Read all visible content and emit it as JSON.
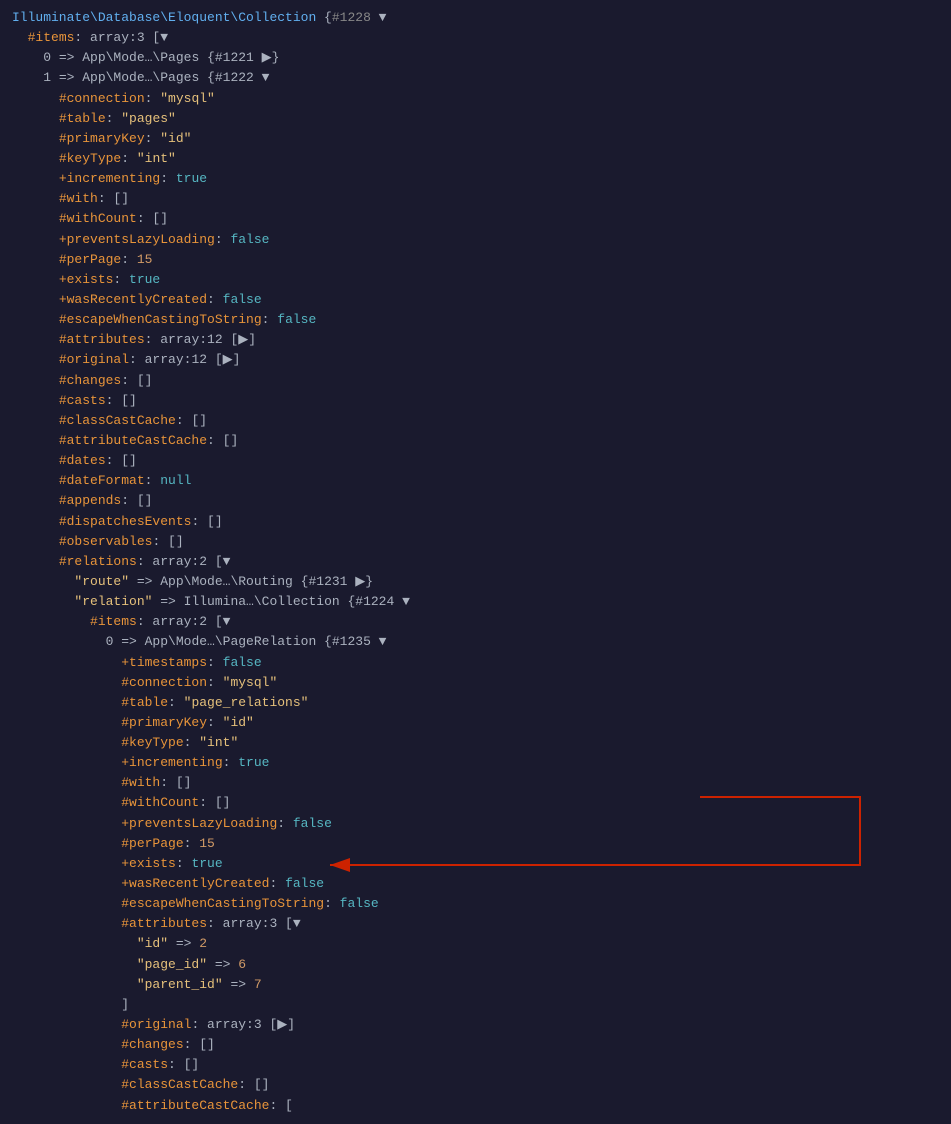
{
  "title": "Illuminate\\Database\\Eloquent\\Collection {#1228}",
  "lines": [
    {
      "indent": 0,
      "content": [
        {
          "t": "class",
          "v": "Illuminate\\Database\\Eloquent\\Collection",
          "c": "classname"
        },
        {
          "t": "plain",
          "v": " {",
          "c": "gray"
        },
        {
          "t": "plain",
          "v": "#1228",
          "c": "id-hash"
        },
        {
          "t": "plain",
          "v": " ▼",
          "c": "gray"
        }
      ]
    },
    {
      "indent": 1,
      "content": [
        {
          "t": "plain",
          "v": "#items",
          "c": "hash-key"
        },
        {
          "t": "plain",
          "v": ": array:3 [▼",
          "c": "gray"
        }
      ]
    },
    {
      "indent": 2,
      "content": [
        {
          "t": "plain",
          "v": "0 => App\\Mode…\\Pages {#1221 ▶}",
          "c": "gray"
        }
      ]
    },
    {
      "indent": 2,
      "content": [
        {
          "t": "plain",
          "v": "1 => App\\Mode…\\Pages {#1222 ▼",
          "c": "gray"
        }
      ]
    },
    {
      "indent": 3,
      "content": [
        {
          "t": "plain",
          "v": "#connection",
          "c": "hash-key"
        },
        {
          "t": "plain",
          "v": ": ",
          "c": "gray"
        },
        {
          "t": "plain",
          "v": "\"mysql\"",
          "c": "string"
        }
      ]
    },
    {
      "indent": 3,
      "content": [
        {
          "t": "plain",
          "v": "#table",
          "c": "hash-key"
        },
        {
          "t": "plain",
          "v": ": ",
          "c": "gray"
        },
        {
          "t": "plain",
          "v": "\"pages\"",
          "c": "string"
        }
      ]
    },
    {
      "indent": 3,
      "content": [
        {
          "t": "plain",
          "v": "#primaryKey",
          "c": "hash-key"
        },
        {
          "t": "plain",
          "v": ": ",
          "c": "gray"
        },
        {
          "t": "plain",
          "v": "\"id\"",
          "c": "string"
        }
      ]
    },
    {
      "indent": 3,
      "content": [
        {
          "t": "plain",
          "v": "#keyType",
          "c": "hash-key"
        },
        {
          "t": "plain",
          "v": ": ",
          "c": "gray"
        },
        {
          "t": "plain",
          "v": "\"int\"",
          "c": "string"
        }
      ]
    },
    {
      "indent": 3,
      "content": [
        {
          "t": "plain",
          "v": "+incrementing",
          "c": "plus-key"
        },
        {
          "t": "plain",
          "v": ": ",
          "c": "gray"
        },
        {
          "t": "plain",
          "v": "true",
          "c": "kw-true"
        }
      ]
    },
    {
      "indent": 3,
      "content": [
        {
          "t": "plain",
          "v": "#with",
          "c": "hash-key"
        },
        {
          "t": "plain",
          "v": ": []",
          "c": "gray"
        }
      ]
    },
    {
      "indent": 3,
      "content": [
        {
          "t": "plain",
          "v": "#withCount",
          "c": "hash-key"
        },
        {
          "t": "plain",
          "v": ": []",
          "c": "gray"
        }
      ]
    },
    {
      "indent": 3,
      "content": [
        {
          "t": "plain",
          "v": "+preventsLazyLoading",
          "c": "plus-key"
        },
        {
          "t": "plain",
          "v": ": ",
          "c": "gray"
        },
        {
          "t": "plain",
          "v": "false",
          "c": "kw-false"
        }
      ]
    },
    {
      "indent": 3,
      "content": [
        {
          "t": "plain",
          "v": "#perPage",
          "c": "hash-key"
        },
        {
          "t": "plain",
          "v": ": ",
          "c": "gray"
        },
        {
          "t": "plain",
          "v": "15",
          "c": "num"
        }
      ]
    },
    {
      "indent": 3,
      "content": [
        {
          "t": "plain",
          "v": "+exists",
          "c": "plus-key"
        },
        {
          "t": "plain",
          "v": ": ",
          "c": "gray"
        },
        {
          "t": "plain",
          "v": "true",
          "c": "kw-true"
        }
      ]
    },
    {
      "indent": 3,
      "content": [
        {
          "t": "plain",
          "v": "+wasRecentlyCreated",
          "c": "plus-key"
        },
        {
          "t": "plain",
          "v": ": ",
          "c": "gray"
        },
        {
          "t": "plain",
          "v": "false",
          "c": "kw-false"
        }
      ]
    },
    {
      "indent": 3,
      "content": [
        {
          "t": "plain",
          "v": "#escapeWhenCastingToString",
          "c": "hash-key"
        },
        {
          "t": "plain",
          "v": ": ",
          "c": "gray"
        },
        {
          "t": "plain",
          "v": "false",
          "c": "kw-false"
        }
      ]
    },
    {
      "indent": 3,
      "content": [
        {
          "t": "plain",
          "v": "#attributes",
          "c": "hash-key"
        },
        {
          "t": "plain",
          "v": ": array:12 [▶]",
          "c": "gray"
        }
      ]
    },
    {
      "indent": 3,
      "content": [
        {
          "t": "plain",
          "v": "#original",
          "c": "hash-key"
        },
        {
          "t": "plain",
          "v": ": array:12 [▶]",
          "c": "gray"
        }
      ]
    },
    {
      "indent": 3,
      "content": [
        {
          "t": "plain",
          "v": "#changes",
          "c": "hash-key"
        },
        {
          "t": "plain",
          "v": ": []",
          "c": "gray"
        }
      ]
    },
    {
      "indent": 3,
      "content": [
        {
          "t": "plain",
          "v": "#casts",
          "c": "hash-key"
        },
        {
          "t": "plain",
          "v": ": []",
          "c": "gray"
        }
      ]
    },
    {
      "indent": 3,
      "content": [
        {
          "t": "plain",
          "v": "#classCastCache",
          "c": "hash-key"
        },
        {
          "t": "plain",
          "v": ": []",
          "c": "gray"
        }
      ]
    },
    {
      "indent": 3,
      "content": [
        {
          "t": "plain",
          "v": "#attributeCastCache",
          "c": "hash-key"
        },
        {
          "t": "plain",
          "v": ": []",
          "c": "gray"
        }
      ]
    },
    {
      "indent": 3,
      "content": [
        {
          "t": "plain",
          "v": "#dates",
          "c": "hash-key"
        },
        {
          "t": "plain",
          "v": ": []",
          "c": "gray"
        }
      ]
    },
    {
      "indent": 3,
      "content": [
        {
          "t": "plain",
          "v": "#dateFormat",
          "c": "hash-key"
        },
        {
          "t": "plain",
          "v": ": ",
          "c": "gray"
        },
        {
          "t": "plain",
          "v": "null",
          "c": "kw-null"
        }
      ]
    },
    {
      "indent": 3,
      "content": [
        {
          "t": "plain",
          "v": "#appends",
          "c": "hash-key"
        },
        {
          "t": "plain",
          "v": ": []",
          "c": "gray"
        }
      ]
    },
    {
      "indent": 3,
      "content": [
        {
          "t": "plain",
          "v": "#dispatchesEvents",
          "c": "hash-key"
        },
        {
          "t": "plain",
          "v": ": []",
          "c": "gray"
        }
      ]
    },
    {
      "indent": 3,
      "content": [
        {
          "t": "plain",
          "v": "#observables",
          "c": "hash-key"
        },
        {
          "t": "plain",
          "v": ": []",
          "c": "gray"
        }
      ]
    },
    {
      "indent": 3,
      "content": [
        {
          "t": "plain",
          "v": "#relations",
          "c": "hash-key"
        },
        {
          "t": "plain",
          "v": ": array:2 [▼",
          "c": "gray"
        }
      ]
    },
    {
      "indent": 4,
      "content": [
        {
          "t": "plain",
          "v": "\"route\"",
          "c": "string"
        },
        {
          "t": "plain",
          "v": " => App\\Mode…\\Routing {#1231 ▶}",
          "c": "gray"
        }
      ]
    },
    {
      "indent": 4,
      "content": [
        {
          "t": "plain",
          "v": "\"relation\"",
          "c": "string"
        },
        {
          "t": "plain",
          "v": " => Illumina…\\Collection {#1224 ▼",
          "c": "gray"
        }
      ]
    },
    {
      "indent": 5,
      "content": [
        {
          "t": "plain",
          "v": "#items",
          "c": "hash-key"
        },
        {
          "t": "plain",
          "v": ": array:2 [▼",
          "c": "gray"
        }
      ]
    },
    {
      "indent": 6,
      "content": [
        {
          "t": "plain",
          "v": "0 => App\\Mode…\\PageRelation {#1235 ▼",
          "c": "gray"
        }
      ]
    },
    {
      "indent": 7,
      "content": [
        {
          "t": "plain",
          "v": "+timestamps",
          "c": "plus-key"
        },
        {
          "t": "plain",
          "v": ": ",
          "c": "gray"
        },
        {
          "t": "plain",
          "v": "false",
          "c": "kw-false"
        }
      ]
    },
    {
      "indent": 7,
      "content": [
        {
          "t": "plain",
          "v": "#connection",
          "c": "hash-key"
        },
        {
          "t": "plain",
          "v": ": ",
          "c": "gray"
        },
        {
          "t": "plain",
          "v": "\"mysql\"",
          "c": "string"
        }
      ]
    },
    {
      "indent": 7,
      "content": [
        {
          "t": "plain",
          "v": "#table",
          "c": "hash-key"
        },
        {
          "t": "plain",
          "v": ": ",
          "c": "gray"
        },
        {
          "t": "plain",
          "v": "\"page_relations\"",
          "c": "string"
        }
      ]
    },
    {
      "indent": 7,
      "content": [
        {
          "t": "plain",
          "v": "#primaryKey",
          "c": "hash-key"
        },
        {
          "t": "plain",
          "v": ": ",
          "c": "gray"
        },
        {
          "t": "plain",
          "v": "\"id\"",
          "c": "string"
        }
      ]
    },
    {
      "indent": 7,
      "content": [
        {
          "t": "plain",
          "v": "#keyType",
          "c": "hash-key"
        },
        {
          "t": "plain",
          "v": ": ",
          "c": "gray"
        },
        {
          "t": "plain",
          "v": "\"int\"",
          "c": "string"
        }
      ]
    },
    {
      "indent": 7,
      "content": [
        {
          "t": "plain",
          "v": "+incrementing",
          "c": "plus-key"
        },
        {
          "t": "plain",
          "v": ": ",
          "c": "gray"
        },
        {
          "t": "plain",
          "v": "true",
          "c": "kw-true"
        }
      ]
    },
    {
      "indent": 7,
      "content": [
        {
          "t": "plain",
          "v": "#with",
          "c": "hash-key"
        },
        {
          "t": "plain",
          "v": ": []",
          "c": "gray"
        }
      ]
    },
    {
      "indent": 7,
      "content": [
        {
          "t": "plain",
          "v": "#withCount",
          "c": "hash-key"
        },
        {
          "t": "plain",
          "v": ": []",
          "c": "gray"
        }
      ]
    },
    {
      "indent": 7,
      "content": [
        {
          "t": "plain",
          "v": "+preventsLazyLoading",
          "c": "plus-key"
        },
        {
          "t": "plain",
          "v": ": ",
          "c": "gray"
        },
        {
          "t": "plain",
          "v": "false",
          "c": "kw-false"
        }
      ]
    },
    {
      "indent": 7,
      "content": [
        {
          "t": "plain",
          "v": "#perPage",
          "c": "hash-key"
        },
        {
          "t": "plain",
          "v": ": ",
          "c": "gray"
        },
        {
          "t": "plain",
          "v": "15",
          "c": "num"
        }
      ]
    },
    {
      "indent": 7,
      "content": [
        {
          "t": "plain",
          "v": "+exists",
          "c": "plus-key"
        },
        {
          "t": "plain",
          "v": ": ",
          "c": "gray"
        },
        {
          "t": "plain",
          "v": "true",
          "c": "kw-true"
        }
      ]
    },
    {
      "indent": 7,
      "content": [
        {
          "t": "plain",
          "v": "+wasRecentlyCreated",
          "c": "plus-key"
        },
        {
          "t": "plain",
          "v": ": ",
          "c": "gray"
        },
        {
          "t": "plain",
          "v": "false",
          "c": "kw-false"
        }
      ]
    },
    {
      "indent": 7,
      "content": [
        {
          "t": "plain",
          "v": "#escapeWhenCastingToString",
          "c": "hash-key"
        },
        {
          "t": "plain",
          "v": ": ",
          "c": "gray"
        },
        {
          "t": "plain",
          "v": "false",
          "c": "kw-false"
        }
      ]
    },
    {
      "indent": 7,
      "content": [
        {
          "t": "plain",
          "v": "#attributes",
          "c": "hash-key"
        },
        {
          "t": "plain",
          "v": ": array:3 [▼",
          "c": "gray"
        },
        {
          "t": "arrow",
          "v": ""
        }
      ]
    },
    {
      "indent": 8,
      "content": [
        {
          "t": "plain",
          "v": "\"id\"",
          "c": "string"
        },
        {
          "t": "plain",
          "v": " => ",
          "c": "gray"
        },
        {
          "t": "plain",
          "v": "2",
          "c": "num"
        }
      ]
    },
    {
      "indent": 8,
      "content": [
        {
          "t": "plain",
          "v": "\"page_id\"",
          "c": "string"
        },
        {
          "t": "plain",
          "v": " => ",
          "c": "gray"
        },
        {
          "t": "plain",
          "v": "6",
          "c": "num"
        },
        {
          "t": "arrow-target",
          "v": ""
        }
      ]
    },
    {
      "indent": 8,
      "content": [
        {
          "t": "plain",
          "v": "\"parent_id\"",
          "c": "string"
        },
        {
          "t": "plain",
          "v": " => ",
          "c": "gray"
        },
        {
          "t": "plain",
          "v": "7",
          "c": "num"
        }
      ]
    },
    {
      "indent": 7,
      "content": [
        {
          "t": "plain",
          "v": "]",
          "c": "gray"
        }
      ]
    },
    {
      "indent": 7,
      "content": [
        {
          "t": "plain",
          "v": "#original",
          "c": "hash-key"
        },
        {
          "t": "plain",
          "v": ": array:3 [▶]",
          "c": "gray"
        }
      ]
    },
    {
      "indent": 7,
      "content": [
        {
          "t": "plain",
          "v": "#changes",
          "c": "hash-key"
        },
        {
          "t": "plain",
          "v": ": []",
          "c": "gray"
        }
      ]
    },
    {
      "indent": 7,
      "content": [
        {
          "t": "plain",
          "v": "#casts",
          "c": "hash-key"
        },
        {
          "t": "plain",
          "v": ": []",
          "c": "gray"
        }
      ]
    },
    {
      "indent": 7,
      "content": [
        {
          "t": "plain",
          "v": "#classCastCache",
          "c": "hash-key"
        },
        {
          "t": "plain",
          "v": ": []",
          "c": "gray"
        }
      ]
    },
    {
      "indent": 7,
      "content": [
        {
          "t": "plain",
          "v": "#attributeCastCache",
          "c": "hash-key"
        },
        {
          "t": "plain",
          "v": ": [",
          "c": "gray"
        }
      ]
    }
  ],
  "colors": {
    "bg": "#1a1a2e",
    "hash_key": "#e8943a",
    "string": "#e5c07b",
    "keyword": "#56b6c2",
    "number": "#d19a66",
    "classname": "#61afef",
    "plain": "#abb2bf",
    "arrow_red": "#cc0000"
  }
}
